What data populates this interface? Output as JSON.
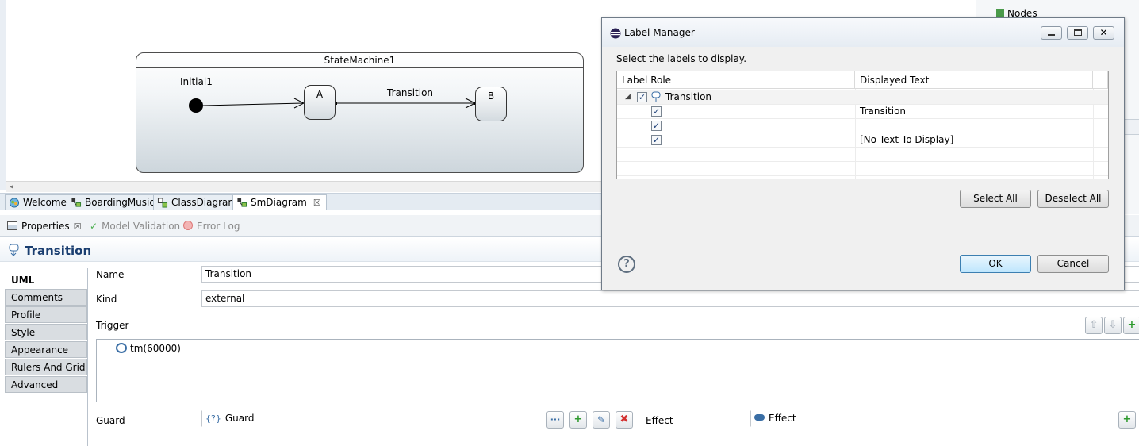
{
  "diagram": {
    "state_machine_title": "StateMachine1",
    "initial_label": "Initial1",
    "state_a": "A",
    "state_b": "B",
    "transition_label": "Transition"
  },
  "outline": {
    "nodes_label": "Nodes"
  },
  "editor_tabs": [
    {
      "label": "Welcome"
    },
    {
      "label": "BoardingMusic"
    },
    {
      "label": "ClassDiagram"
    },
    {
      "label": "SmDiagram",
      "active": true,
      "close": "☒"
    }
  ],
  "properties": {
    "tabs": [
      {
        "label": "Properties",
        "close": "☒"
      },
      {
        "label": "Model Validation"
      },
      {
        "label": "Error Log"
      }
    ],
    "title": "Transition",
    "categories": [
      "UML",
      "Comments",
      "Profile",
      "Style",
      "Appearance",
      "Rulers And Grid",
      "Advanced"
    ],
    "form": {
      "name_label": "Name",
      "name_value": "Transition",
      "kind_label": "Kind",
      "kind_value": "external",
      "trigger_label": "Trigger",
      "trigger_items": [
        "tm(60000)"
      ],
      "guard_label": "Guard",
      "guard_value": "Guard",
      "guard_prefix": "{?}",
      "effect_label": "Effect",
      "effect_value": "Effect"
    }
  },
  "dialog": {
    "title": "Label Manager",
    "instruction": "Select the labels to display.",
    "columns": [
      "Label Role",
      "Displayed Text"
    ],
    "rows": [
      {
        "role": "Transition",
        "text": "",
        "checked": true,
        "parent": true
      },
      {
        "role": "",
        "text": "Transition",
        "checked": true
      },
      {
        "role": "",
        "text": "",
        "checked": true
      },
      {
        "role": "",
        "text": "[No Text To Display]",
        "checked": true
      }
    ],
    "select_all": "Select All",
    "deselect_all": "Deselect All",
    "ok": "OK",
    "cancel": "Cancel",
    "help": "?"
  },
  "colors": {
    "title_blue": "#1a3e70",
    "accent": "#3c7fb1"
  }
}
